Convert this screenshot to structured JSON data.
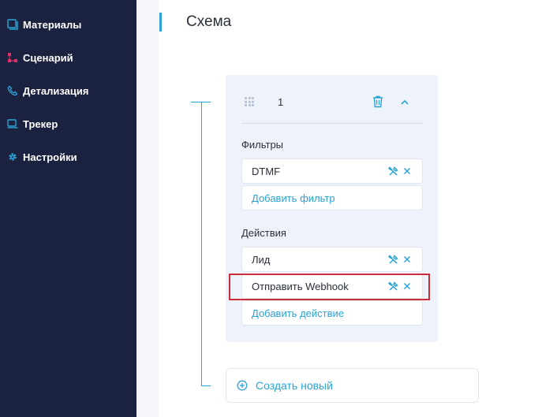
{
  "sidebar": {
    "items": [
      {
        "label": "Материалы",
        "icon": "materials-icon"
      },
      {
        "label": "Сценарий",
        "icon": "scenario-icon"
      },
      {
        "label": "Детализация",
        "icon": "phone-icon"
      },
      {
        "label": "Трекер",
        "icon": "tracker-icon"
      },
      {
        "label": "Настройки",
        "icon": "gear-icon"
      }
    ]
  },
  "page": {
    "title": "Схема"
  },
  "card": {
    "number": "1",
    "filters_label": "Фильтры",
    "filters": [
      "DTMF"
    ],
    "add_filter": "Добавить фильтр",
    "actions_label": "Действия",
    "actions": [
      "Лид",
      "Отправить Webhook"
    ],
    "add_action": "Добавить действие"
  },
  "create_new": "Создать новый",
  "colors": {
    "sidebar_bg": "#1b223f",
    "accent": "#2aa3d6",
    "highlight": "#cc2e3a",
    "card_bg": "#eef2fb"
  }
}
